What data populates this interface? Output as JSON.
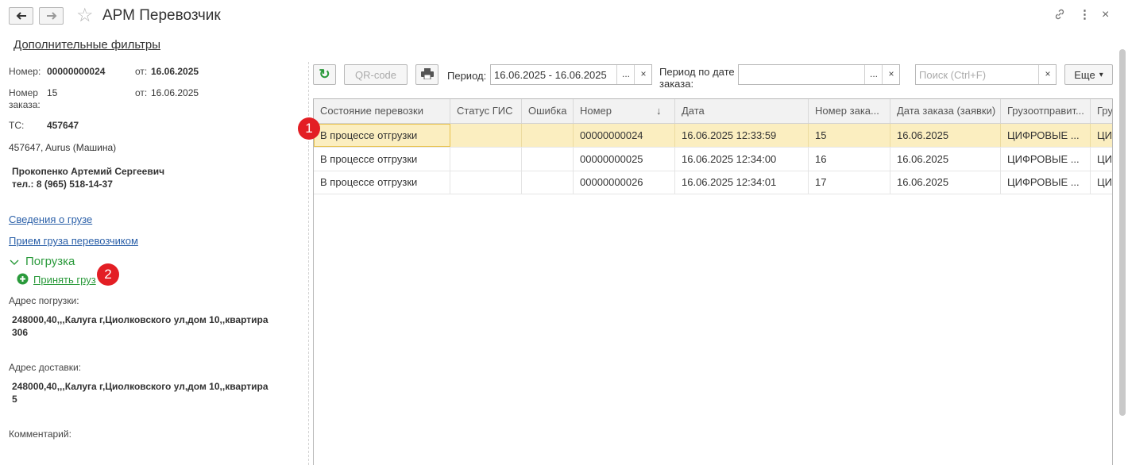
{
  "header": {
    "title": "АРМ Перевозчик",
    "back_glyph": "🡐",
    "fwd_glyph": "🡒",
    "star_glyph": "☆",
    "link_glyph": "🔗",
    "more_glyph": "⋮",
    "close_glyph": "×"
  },
  "filters_link": "Дополнительные фильтры",
  "left": {
    "number_label": "Номер:",
    "number_value": "00000000024",
    "from_label": "от:",
    "from_value": "16.06.2025",
    "order_label_1": "Номер",
    "order_label_2": "заказа:",
    "order_value": "15",
    "order_from_label": "от:",
    "order_from_value": "16.06.2025",
    "ts_label": "ТС:",
    "ts_value": "457647",
    "vehicle": "457647, Aurus (Машина)",
    "driver_name": "Прокопенко Артемий Сергеевич",
    "driver_phone": "тел.: 8 (965) 518-14-37",
    "cargo_info_link": "Сведения о грузе",
    "cargo_accept_link": "Прием груза перевозчиком",
    "loading_section": "Погрузка",
    "accept_cargo_link": "Принять груз",
    "loading_address_label": "Адрес погрузки:",
    "loading_address_1": "248000,40,,,Калуга г,Циолковского ул,дом 10,,квартира",
    "loading_address_2": "306",
    "delivery_address_label": "Адрес доставки:",
    "delivery_address_1": "248000,40,,,Калуга г,Циолковского ул,дом 10,,квартира",
    "delivery_address_2": "5",
    "comment_label": "Комментарий:"
  },
  "toolbar": {
    "refresh_glyph": "↻",
    "qr_label": "QR-code",
    "print_glyph": "🖶",
    "period_label": "Период:",
    "period_value": "16.06.2025 - 16.06.2025",
    "dots": "...",
    "clear": "×",
    "order_period_label_1": "Период по дате",
    "order_period_label_2": "заказа:",
    "order_period_value": "",
    "search_placeholder": "Поиск (Ctrl+F)",
    "more_label": "Еще",
    "more_caret": "▾"
  },
  "table": {
    "columns": [
      "Состояние перевозки",
      "Статус ГИС",
      "Ошибка",
      "Номер",
      "Дата",
      "Номер зака...",
      "Дата заказа (заявки)",
      "Грузоотправит...",
      "Гру"
    ],
    "sort_glyph": "↓",
    "rows": [
      [
        "В процессе отгрузки",
        "",
        "",
        "00000000024",
        "16.06.2025 12:33:59",
        "15",
        "16.06.2025",
        "ЦИФРОВЫЕ ...",
        "ЦИ"
      ],
      [
        "В процессе отгрузки",
        "",
        "",
        "00000000025",
        "16.06.2025 12:34:00",
        "16",
        "16.06.2025",
        "ЦИФРОВЫЕ ...",
        "ЦИ"
      ],
      [
        "В процессе отгрузки",
        "",
        "",
        "00000000026",
        "16.06.2025 12:34:01",
        "17",
        "16.06.2025",
        "ЦИФРОВЫЕ ...",
        "ЦИ"
      ]
    ]
  },
  "badges": {
    "one": "1",
    "two": "2"
  },
  "colors": {
    "accent_green": "#2a9a3b",
    "link_blue": "#2a5fa8",
    "selected_row": "#fbeec0",
    "badge_red": "#e31e24"
  }
}
